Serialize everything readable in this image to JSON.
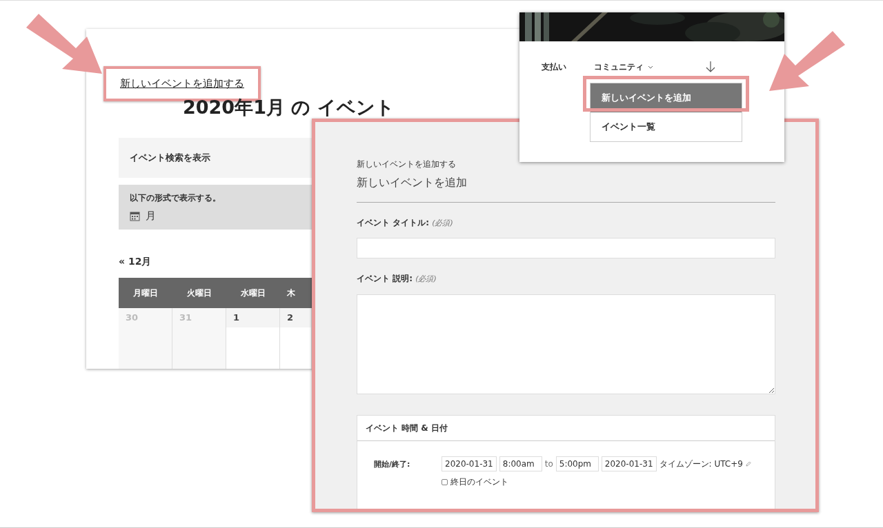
{
  "calendar_page": {
    "add_link": {
      "label": "新しいイベントを追加する",
      "highlighted": true
    },
    "title": "2020年1月 の イベント",
    "search_toggle": "イベント検索を表示",
    "format_label": "以下の形式で表示する。",
    "format_value": "月",
    "prev_month": "« 12月",
    "weekdays": [
      "月曜日",
      "火曜日",
      "水曜日",
      "木"
    ],
    "days": [
      {
        "label": "30",
        "other_month": true
      },
      {
        "label": "31",
        "other_month": true
      },
      {
        "label": "1",
        "other_month": false
      },
      {
        "label": "2",
        "other_month": false
      }
    ]
  },
  "menu_page": {
    "nav": [
      {
        "label": "支払い",
        "dropdown": false
      },
      {
        "label": "コミュニティ",
        "dropdown": true
      }
    ],
    "dropdown_items": [
      {
        "label": "新しいイベントを追加",
        "selected": true,
        "highlighted": true
      },
      {
        "label": "イベント一覧",
        "selected": false,
        "highlighted": false
      }
    ]
  },
  "form": {
    "highlighted": true,
    "breadcrumb": "新しいイベントを追加する",
    "title": "新しいイベントを追加",
    "fields": [
      {
        "label": "イベント タイトル:",
        "required": "(必須)",
        "kind": "text"
      },
      {
        "label": "イベント 説明:",
        "required": "(必須)",
        "kind": "textarea"
      }
    ],
    "section": {
      "title": "イベント 時間 & 日付",
      "row_label": "開始/終了:",
      "start_date": "2020-01-31",
      "start_time": "8:00am",
      "separator": "to",
      "end_time": "5:00pm",
      "end_date": "2020-01-31",
      "timezone": "タイムゾーン: UTC+9",
      "all_day": {
        "label": "終日のイベント",
        "checked": false
      }
    }
  }
}
